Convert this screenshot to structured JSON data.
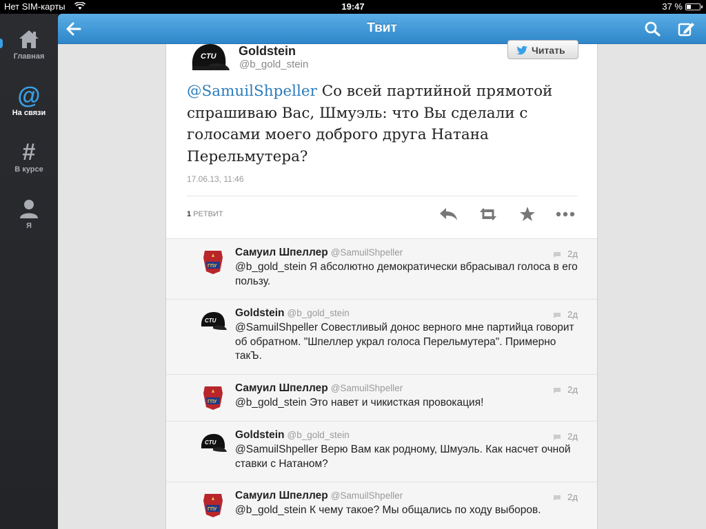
{
  "status": {
    "carrier": "Нет SIM-карты",
    "time": "19:47",
    "battery": "37 %"
  },
  "sidebar": {
    "items": [
      {
        "label": "Главная",
        "icon": "home-icon",
        "active": false
      },
      {
        "label": "На связи",
        "icon": "at-icon",
        "active": true
      },
      {
        "label": "В курсе",
        "icon": "hash-icon",
        "active": false
      },
      {
        "label": "Я",
        "icon": "person-icon",
        "active": false
      }
    ],
    "at_glyph": "@",
    "hash_glyph": "#"
  },
  "topbar": {
    "title": "Твит"
  },
  "tweet": {
    "name": "Goldstein",
    "handle": "@b_gold_stein",
    "avatar_text": "CTU",
    "follow_label": "Читать",
    "mention": "@SamuilShpeller",
    "text": " Со всей партийной прямотой спрашиваю Вас, Шмуэль: что Вы сделали с голосами моего доброго друга Натана Перельмутера?",
    "timestamp": "17.06.13, 11:46",
    "retweet_count": "1",
    "retweet_label": "РЕТВИТ"
  },
  "replies": [
    {
      "name": "Самуил Шпеллер",
      "handle": "@SamuilShpeller",
      "avatar": "gpu-badge",
      "time": "2д",
      "text": "@b_gold_stein Я абсолютно демократически вбрасывал голоса в его пользу."
    },
    {
      "name": "Goldstein",
      "handle": "@b_gold_stein",
      "avatar": "ctu-cap",
      "time": "2д",
      "text": "@SamuilShpeller Совестливый донос верного мне партийца говорит об обратном. \"Шпеллер украл голоса Перельмутера\". Примерно такЪ."
    },
    {
      "name": "Самуил Шпеллер",
      "handle": "@SamuilShpeller",
      "avatar": "gpu-badge",
      "time": "2д",
      "text": "@b_gold_stein Это навет и чикисткая провокация!"
    },
    {
      "name": "Goldstein",
      "handle": "@b_gold_stein",
      "avatar": "ctu-cap",
      "time": "2д",
      "text": "@SamuilShpeller Верю Вам как родному, Шмуэль. Как насчет очной ставки с Натаном?"
    },
    {
      "name": "Самуил Шпеллер",
      "handle": "@SamuilShpeller",
      "avatar": "gpu-badge",
      "time": "2д",
      "text": "@b_gold_stein К чему такое? Мы общались по ходу выборов."
    }
  ],
  "colors": {
    "accent": "#2f86c9",
    "mention": "#2b7bb9",
    "badge_red": "#b8262b"
  }
}
